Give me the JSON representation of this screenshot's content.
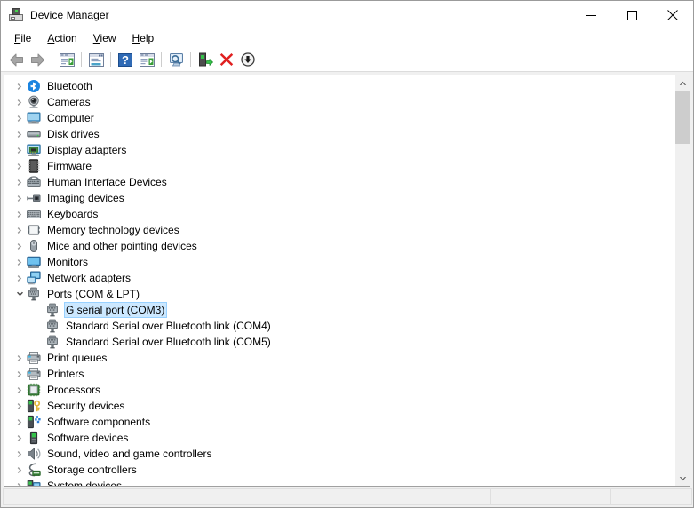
{
  "window": {
    "title": "Device Manager",
    "icon": "device-manager-icon",
    "controls": {
      "minimize": "minimize-button",
      "maximize": "maximize-button",
      "close": "close-button"
    }
  },
  "menubar": {
    "items": [
      {
        "label": "File",
        "accesskey": "F"
      },
      {
        "label": "Action",
        "accesskey": "A"
      },
      {
        "label": "View",
        "accesskey": "V"
      },
      {
        "label": "Help",
        "accesskey": "H"
      }
    ]
  },
  "toolbar": {
    "buttons": [
      {
        "name": "back-button",
        "icon": "arrow-left-icon"
      },
      {
        "name": "forward-button",
        "icon": "arrow-right-icon"
      },
      {
        "name": "show-hide-console-tree-button",
        "icon": "console-tree-icon"
      },
      {
        "name": "properties-button",
        "icon": "properties-window-icon"
      },
      {
        "name": "help-button",
        "icon": "question-mark-icon"
      },
      {
        "name": "show-hide-action-pane-button",
        "icon": "action-pane-icon"
      },
      {
        "name": "scan-for-hardware-changes-button",
        "icon": "monitor-magnifier-icon"
      },
      {
        "name": "update-driver-button",
        "icon": "device-update-icon"
      },
      {
        "name": "uninstall-device-button",
        "icon": "red-x-icon"
      },
      {
        "name": "disable-device-button",
        "icon": "down-arrow-circle-icon"
      }
    ]
  },
  "tree": {
    "nodes": [
      {
        "label": "Bluetooth",
        "icon": "bluetooth-icon",
        "level": 0,
        "state": "collapsed",
        "selected": false
      },
      {
        "label": "Cameras",
        "icon": "camera-icon",
        "level": 0,
        "state": "collapsed",
        "selected": false
      },
      {
        "label": "Computer",
        "icon": "computer-icon",
        "level": 0,
        "state": "collapsed",
        "selected": false
      },
      {
        "label": "Disk drives",
        "icon": "disk-drive-icon",
        "level": 0,
        "state": "collapsed",
        "selected": false
      },
      {
        "label": "Display adapters",
        "icon": "display-adapter-icon",
        "level": 0,
        "state": "collapsed",
        "selected": false
      },
      {
        "label": "Firmware",
        "icon": "firmware-chip-icon",
        "level": 0,
        "state": "collapsed",
        "selected": false
      },
      {
        "label": "Human Interface Devices",
        "icon": "hid-icon",
        "level": 0,
        "state": "collapsed",
        "selected": false
      },
      {
        "label": "Imaging devices",
        "icon": "imaging-device-icon",
        "level": 0,
        "state": "collapsed",
        "selected": false
      },
      {
        "label": "Keyboards",
        "icon": "keyboard-icon",
        "level": 0,
        "state": "collapsed",
        "selected": false
      },
      {
        "label": "Memory technology devices",
        "icon": "memory-card-icon",
        "level": 0,
        "state": "collapsed",
        "selected": false
      },
      {
        "label": "Mice and other pointing devices",
        "icon": "mouse-icon",
        "level": 0,
        "state": "collapsed",
        "selected": false
      },
      {
        "label": "Monitors",
        "icon": "monitor-icon",
        "level": 0,
        "state": "collapsed",
        "selected": false
      },
      {
        "label": "Network adapters",
        "icon": "network-adapter-icon",
        "level": 0,
        "state": "collapsed",
        "selected": false
      },
      {
        "label": "Ports (COM & LPT)",
        "icon": "port-icon",
        "level": 0,
        "state": "expanded",
        "selected": false
      },
      {
        "label": "G serial port (COM3)",
        "icon": "port-icon",
        "level": 1,
        "state": "leaf",
        "selected": true
      },
      {
        "label": "Standard Serial over Bluetooth link (COM4)",
        "icon": "port-icon",
        "level": 1,
        "state": "leaf",
        "selected": false
      },
      {
        "label": "Standard Serial over Bluetooth link (COM5)",
        "icon": "port-icon",
        "level": 1,
        "state": "leaf",
        "selected": false
      },
      {
        "label": "Print queues",
        "icon": "printer-queue-icon",
        "level": 0,
        "state": "collapsed",
        "selected": false
      },
      {
        "label": "Printers",
        "icon": "printer-icon",
        "level": 0,
        "state": "collapsed",
        "selected": false
      },
      {
        "label": "Processors",
        "icon": "processor-icon",
        "level": 0,
        "state": "collapsed",
        "selected": false
      },
      {
        "label": "Security devices",
        "icon": "security-key-icon",
        "level": 0,
        "state": "collapsed",
        "selected": false
      },
      {
        "label": "Software components",
        "icon": "software-component-icon",
        "level": 0,
        "state": "collapsed",
        "selected": false
      },
      {
        "label": "Software devices",
        "icon": "software-device-icon",
        "level": 0,
        "state": "collapsed",
        "selected": false
      },
      {
        "label": "Sound, video and game controllers",
        "icon": "speaker-icon",
        "level": 0,
        "state": "collapsed",
        "selected": false
      },
      {
        "label": "Storage controllers",
        "icon": "storage-controller-icon",
        "level": 0,
        "state": "collapsed",
        "selected": false
      },
      {
        "label": "System devices",
        "icon": "system-device-icon",
        "level": 0,
        "state": "collapsed",
        "selected": false
      }
    ]
  },
  "scrollbar": {
    "up_arrow": "scroll-up-arrow",
    "down_arrow": "scroll-down-arrow",
    "thumb_top_pct": 0,
    "thumb_height_pct": 14
  },
  "statusbar": {
    "main": "",
    "middle": "",
    "end": ""
  },
  "colors": {
    "selection_fill": "#cce8ff",
    "selection_border": "#99d1ff",
    "window_chrome": "#f0f0f0",
    "panel_border": "#a0a0a0",
    "scrollbar_thumb": "#cdcdcd"
  }
}
